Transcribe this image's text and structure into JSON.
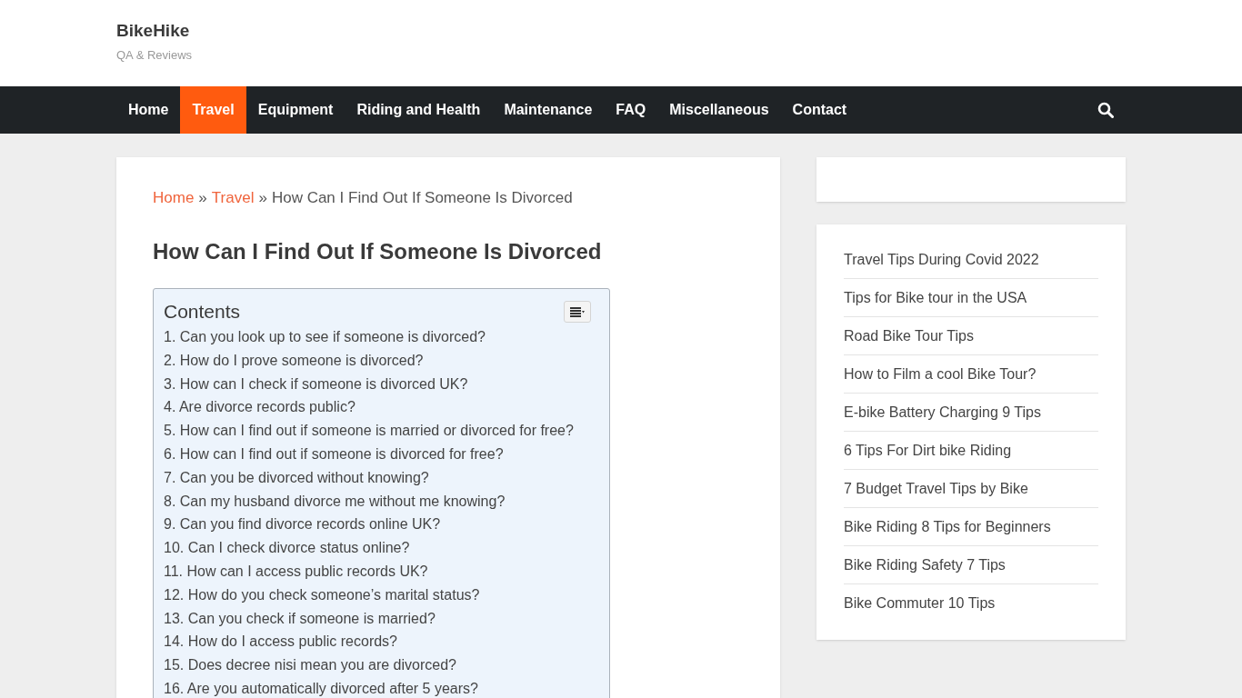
{
  "site": {
    "title": "BikeHike",
    "tagline": "QA & Reviews"
  },
  "nav": {
    "items": [
      {
        "label": "Home",
        "selected": false
      },
      {
        "label": "Travel",
        "selected": true
      },
      {
        "label": "Equipment",
        "selected": false
      },
      {
        "label": "Riding and Health",
        "selected": false
      },
      {
        "label": "Maintenance",
        "selected": false
      },
      {
        "label": "FAQ",
        "selected": false
      },
      {
        "label": "Miscellaneous",
        "selected": false
      },
      {
        "label": "Contact",
        "selected": false
      }
    ]
  },
  "breadcrumb": [
    {
      "kind": "link",
      "text": "Home"
    },
    {
      "kind": "separator",
      "text": "»"
    },
    {
      "kind": "link",
      "text": "Travel"
    },
    {
      "kind": "separator",
      "text": "»"
    },
    {
      "kind": "current",
      "text": "How Can I Find Out If Someone Is Divorced"
    }
  ],
  "article": {
    "title": "How Can I Find Out If Someone Is Divorced",
    "toc": {
      "title": "Contents",
      "items": [
        "1. Can you look up to see if someone is divorced?",
        "2. How do I prove someone is divorced?",
        "3. How can I check if someone is divorced UK?",
        "4. Are divorce records public?",
        "5. How can I find out if someone is married or divorced for free?",
        "6. How can I find out if someone is divorced for free?",
        "7. Can you be divorced without knowing?",
        "8. Can my husband divorce me without me knowing?",
        "9. Can you find divorce records online UK?",
        "10. Can I check divorce status online?",
        "11. How can I access public records UK?",
        "12. How do you check someone’s marital status?",
        "13. Can you check if someone is married?",
        "14. How do I access public records?",
        "15. Does decree nisi mean you are divorced?",
        "16. Are you automatically divorced after 5 years?"
      ]
    }
  },
  "sidebar": {
    "posts": [
      "Travel Tips During Covid 2022",
      "Tips for Bike tour in the USA",
      "Road Bike Tour Tips",
      "How to Film a cool Bike Tour?",
      "E-bike Battery Charging 9 Tips",
      "6 Tips For Dirt bike Riding",
      "7 Budget Travel Tips by Bike",
      "Bike Riding 8 Tips for Beginners",
      "Bike Riding Safety 7 Tips",
      "Bike Commuter 10 Tips"
    ]
  }
}
